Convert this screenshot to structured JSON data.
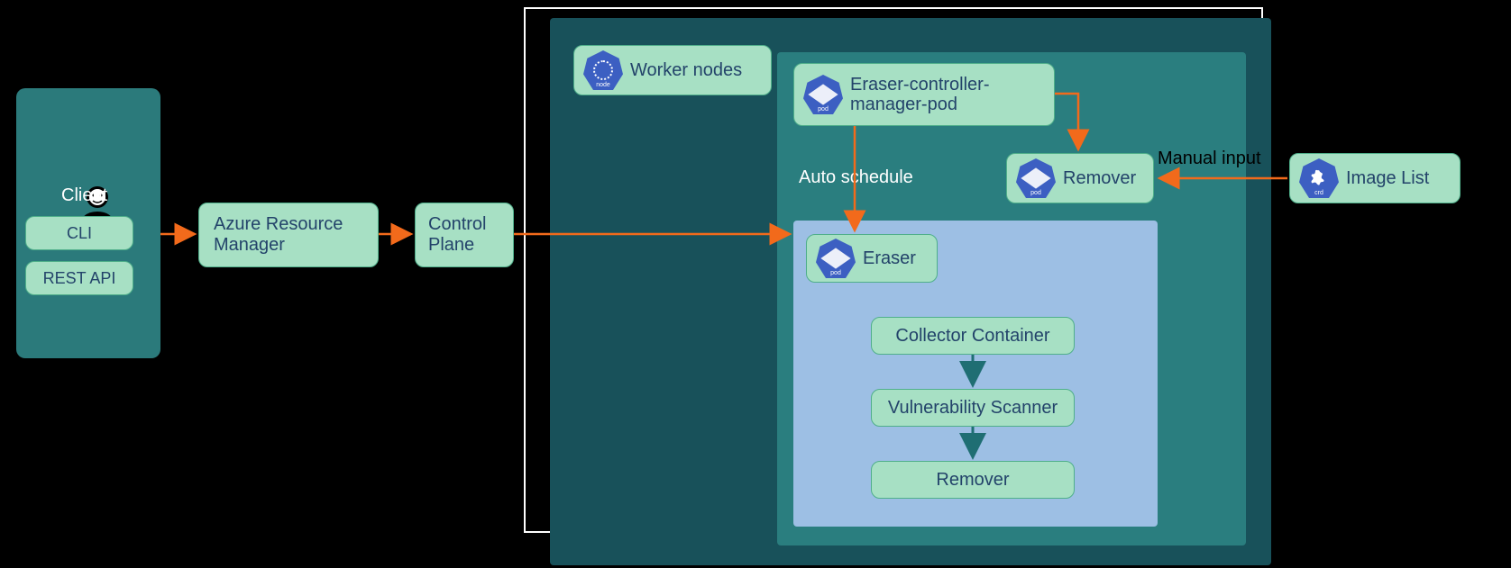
{
  "client": {
    "title": "Client",
    "cli": "CLI",
    "rest": "REST API"
  },
  "arm": "Azure Resource Manager",
  "controlPlane": "Control Plane",
  "workerNodes": "Worker nodes",
  "eraserControllerPod": "Eraser-controller-manager-pod",
  "autoSchedule": "Auto schedule",
  "removerPod": "Remover",
  "manualInput": "Manual input",
  "imageList": "Image List",
  "eraser": "Eraser",
  "collector": "Collector Container",
  "vuln": "Vulnerability Scanner",
  "removerStep": "Remover",
  "icons": {
    "node": "node",
    "pod": "pod",
    "crd": "crd"
  }
}
